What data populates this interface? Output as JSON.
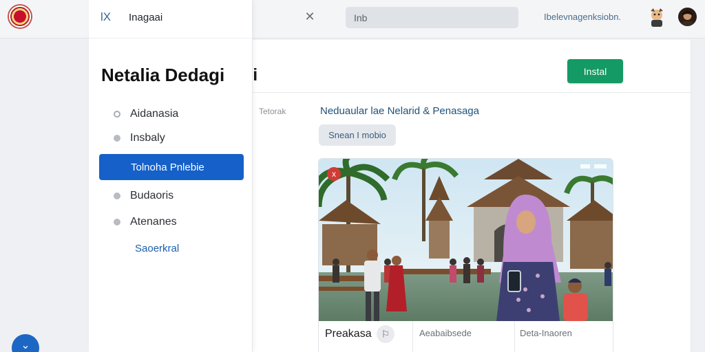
{
  "topbar": {
    "close_icon": "close-icon",
    "search_value": "Inb",
    "link": "Ibelevnagenksiobn."
  },
  "side_panel": {
    "close_label": "lX",
    "title": "Inagaai",
    "page_title": "Netalia Dedagi",
    "items": [
      {
        "label": "Aidanasia"
      },
      {
        "label": "Insbaly"
      },
      {
        "label": "Tolnoha Pnlebie"
      },
      {
        "label": "Budaoris"
      },
      {
        "label": "Atenanes"
      }
    ],
    "link": "Saoerkral"
  },
  "main": {
    "title_tail": "oi",
    "install_label": "Instal",
    "side_label": "Tetorak",
    "section_heading": "Neduaular lae Nelarid & Penasaga",
    "tag_chip": "Snean I mobio",
    "photo_card": {
      "badge": "x",
      "footer": [
        {
          "title": "Preakasa"
        },
        {
          "text": "Aeabaibsede"
        },
        {
          "text": "Deta-Inaoren"
        }
      ]
    }
  },
  "colors": {
    "accent": "#1560c9",
    "install": "#149a64",
    "heading": "#20527a"
  }
}
